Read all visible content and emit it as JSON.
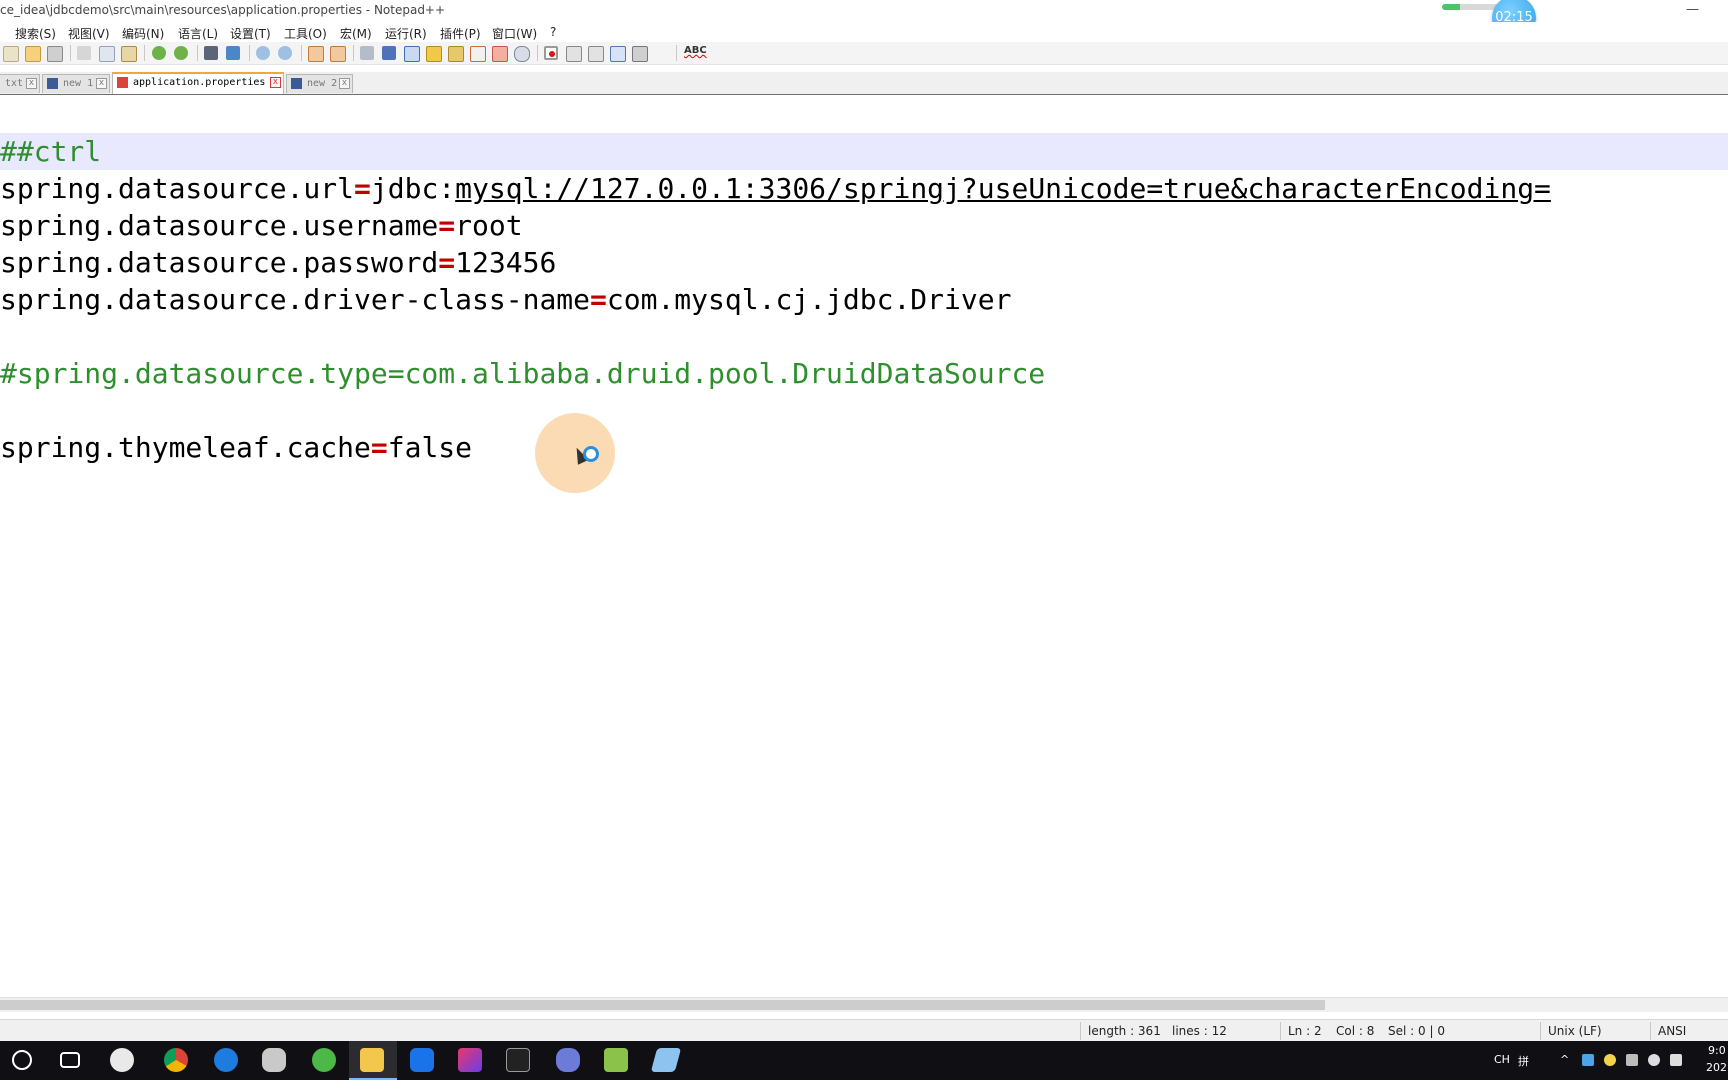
{
  "window": {
    "title": "ce_idea\\jdbcdemo\\src\\main\\resources\\application.properties - Notepad++",
    "timer": "02:15",
    "minimize_glyph": "—",
    "progress": 0.3
  },
  "menu": [
    "搜索(S)",
    "视图(V)",
    "编码(N)",
    "语言(L)",
    "设置(T)",
    "工具(O)",
    "宏(M)",
    "运行(R)",
    "插件(P)",
    "窗口(W)",
    "?"
  ],
  "toolbar": {
    "icons": [
      "new-file-icon",
      "open-file-icon",
      "print-icon",
      "cut-icon",
      "copy-icon",
      "paste-icon",
      "undo-icon",
      "redo-icon",
      "find-icon",
      "replace-icon",
      "zoom-in-icon",
      "zoom-out-icon",
      "sync-vertical-icon",
      "sync-horizontal-icon",
      "word-wrap-icon",
      "show-all-chars-icon",
      "indent-guide-icon",
      "user-lang-icon",
      "doc-map-icon",
      "function-list-icon",
      "folder-workspace-icon",
      "monitor-icon",
      "record-macro-icon",
      "stop-record-icon",
      "playback-macro-icon",
      "run-macro-multiple-icon",
      "save-macro-icon"
    ],
    "spellcheck_label": "ABC"
  },
  "tabs": [
    {
      "label": "txt",
      "active": false
    },
    {
      "label": "new 1",
      "active": false
    },
    {
      "label": "application.properties",
      "active": true
    },
    {
      "label": "new 2",
      "active": false
    }
  ],
  "tab_close_glyph": "x",
  "editor": {
    "line1": "##ctrl",
    "line2_key": "spring.datasource.url",
    "line2_pre": "jdbc:",
    "line2_url": "mysql://127.0.0.1:3306/springj?useUnicode=true&characterEncoding=",
    "line3_key": "spring.datasource.username",
    "line3_val": "root",
    "line4_key": "spring.datasource.password",
    "line4_val": "123456",
    "line5_key": "spring.datasource.driver-class-name",
    "line5_val": "com.mysql.cj.jdbc.Driver",
    "line7": "#spring.datasource.type=com.alibaba.druid.pool.DruidDataSource",
    "line9_key": "spring.thymeleaf.cache",
    "line9_val": "false",
    "eq": "="
  },
  "status": {
    "length": "length : 361",
    "lines": "lines : 12",
    "ln": "Ln : 2",
    "col": "Col : 8",
    "sel": "Sel : 0 | 0",
    "eol": "Unix (LF)",
    "encoding": "ANSI"
  },
  "taskbar": {
    "apps": [
      "cortana-icon",
      "task-view-icon",
      "app-s-icon",
      "chrome-icon",
      "edge-icon",
      "paint-icon",
      "ie-green-icon",
      "file-explorer-icon",
      "star-app-icon",
      "intellij-icon",
      "terminal-icon",
      "shell-app-icon",
      "notepad-plus-icon",
      "eraser-app-icon"
    ],
    "ime": "CH",
    "ime_grid": "拼",
    "tray_up_glyph": "^",
    "time": "9:0",
    "date": "202"
  },
  "colors": {
    "equals": "#c00000",
    "comment": "#2f8f2f",
    "current_line": "#e8e8ff",
    "tab_accent": "#f7a53b"
  }
}
